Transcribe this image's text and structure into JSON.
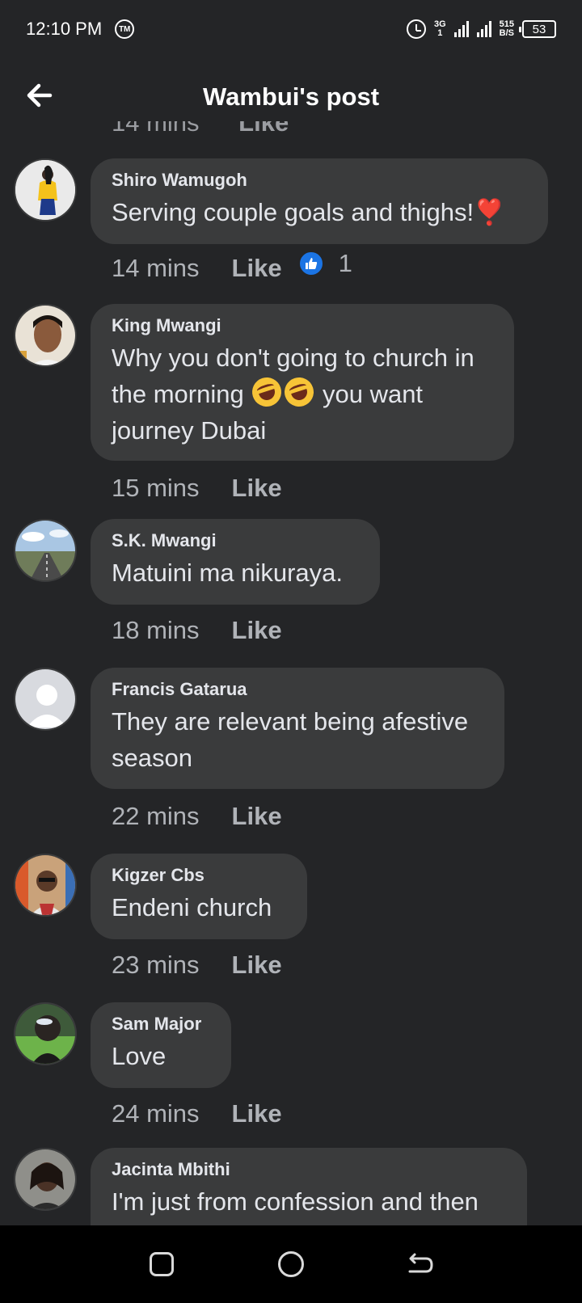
{
  "status_bar": {
    "time": "12:10 PM",
    "left_icon": "TM",
    "network": "3G",
    "network_sub": "1",
    "speed_value": "515",
    "speed_unit": "B/S",
    "battery": "53"
  },
  "header": {
    "title": "Wambui's post",
    "back_icon": "arrow-left-icon"
  },
  "partial_top": {
    "time": "14 mins",
    "like": "Like"
  },
  "comments": [
    {
      "author": "Shiro Wamugoh",
      "time": "14 mins",
      "like": "Like",
      "reaction_count": "1"
    },
    {
      "author": "King Mwangi",
      "time": "15 mins",
      "like": "Like"
    },
    {
      "author": "S.K. Mwangi",
      "text": "Matuini ma nikuraya.",
      "time": "18 mins",
      "like": "Like"
    },
    {
      "author": "Francis Gatarua",
      "time": "22 mins",
      "like": "Like"
    },
    {
      "author": "Kigzer Cbs",
      "text": "Endeni church",
      "time": "23 mins",
      "like": "Like"
    },
    {
      "author": "Sam Major",
      "text": "Love",
      "time": "24 mins",
      "like": "Like"
    },
    {
      "author": "Jacinta Mbithi",
      "text": "I'm just from confession and then"
    }
  ],
  "comment_texts": {
    "c1": "Serving couple goals and thighs!",
    "c1_emoji": "❣️",
    "c2_line1": "Why you don't going to church in",
    "c2_line2a": "the morning",
    "c2_line2b": "you want",
    "c2_line3": "journey Dubai",
    "c4_line1": "They are relevant being afestive",
    "c4_line2": "season"
  },
  "colors": {
    "background": "#242527",
    "bubble": "#3a3b3c",
    "secondary_text": "#b0b3b8",
    "like_blue": "#1b74e4",
    "heart_red": "#e41e3f"
  },
  "nav": [
    "recent-apps-icon",
    "home-icon",
    "back-icon"
  ]
}
